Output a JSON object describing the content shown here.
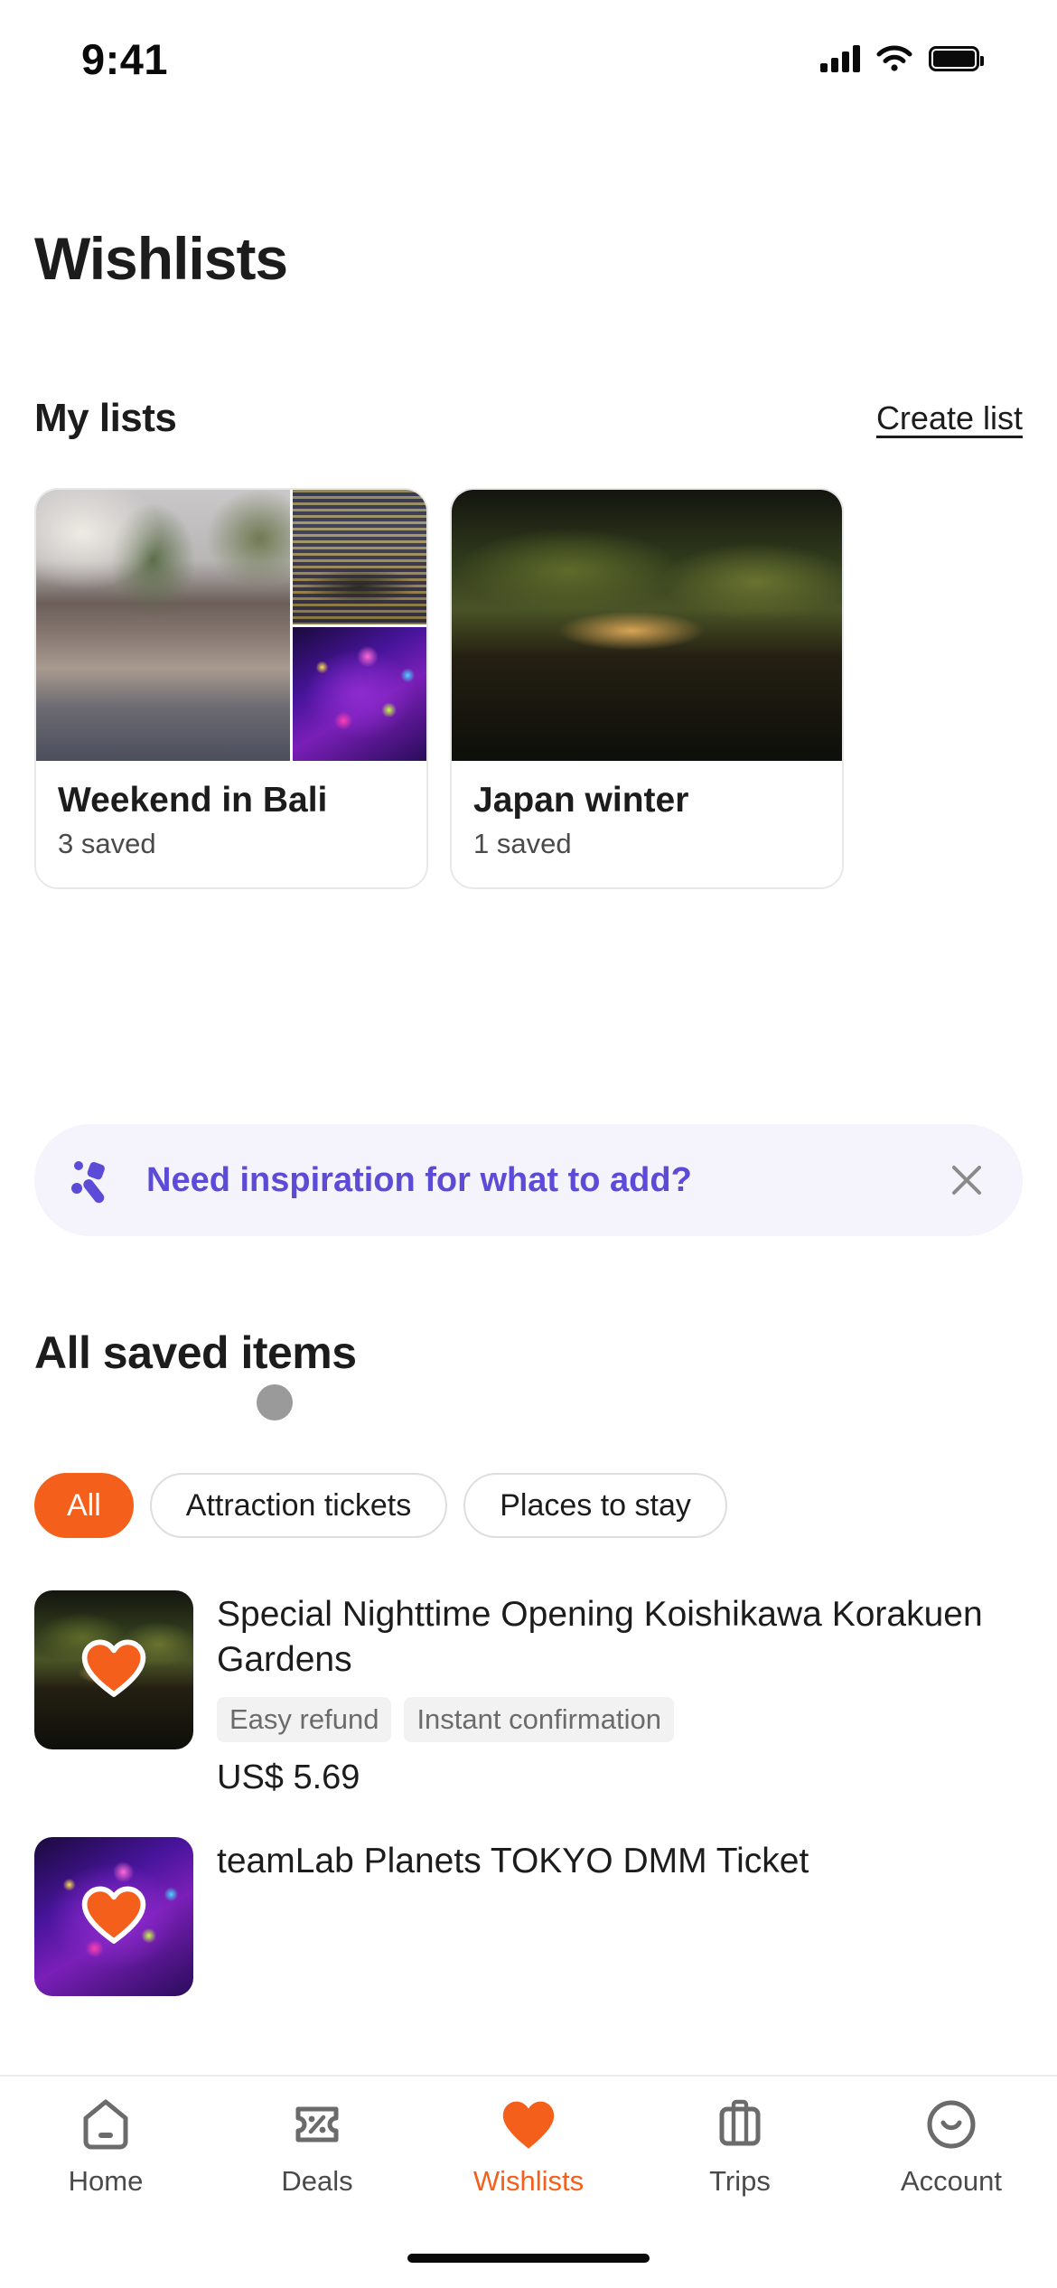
{
  "status_bar": {
    "time": "9:41",
    "signal_icon": "cellular-signal-icon",
    "wifi_icon": "wifi-icon",
    "battery_icon": "battery-icon"
  },
  "header": {
    "title": "Wishlists"
  },
  "my_lists": {
    "section_title": "My lists",
    "create_label": "Create list",
    "cards": [
      {
        "name": "Weekend in Bali",
        "saved_count": "3 saved"
      },
      {
        "name": "Japan winter",
        "saved_count": "1 saved"
      }
    ]
  },
  "inspiration_banner": {
    "icon": "magic-wand-icon",
    "text": "Need inspiration for what to add?",
    "close_icon": "close-icon"
  },
  "all_saved": {
    "title": "All saved items",
    "filters": [
      {
        "label": "All",
        "selected": true
      },
      {
        "label": "Attraction tickets",
        "selected": false
      },
      {
        "label": "Places to stay",
        "selected": false
      }
    ],
    "items": [
      {
        "title": "Special Nighttime Opening Koishikawa Korakuen Gardens",
        "badges": [
          "Easy refund",
          "Instant confirmation"
        ],
        "price": "US$ 5.69",
        "heart_icon": "heart-filled-icon"
      },
      {
        "title": "teamLab Planets TOKYO DMM Ticket",
        "badges": [],
        "price": "",
        "heart_icon": "heart-filled-icon"
      }
    ]
  },
  "tab_bar": {
    "items": [
      {
        "label": "Home",
        "icon": "home-icon",
        "active": false
      },
      {
        "label": "Deals",
        "icon": "ticket-percent-icon",
        "active": false
      },
      {
        "label": "Wishlists",
        "icon": "heart-icon",
        "active": true
      },
      {
        "label": "Trips",
        "icon": "suitcase-icon",
        "active": false
      },
      {
        "label": "Account",
        "icon": "smiley-face-icon",
        "active": false
      }
    ]
  },
  "colors": {
    "accent": "#f4601c",
    "banner_text": "#5b4bd6",
    "banner_bg": "#f5f3fb"
  }
}
